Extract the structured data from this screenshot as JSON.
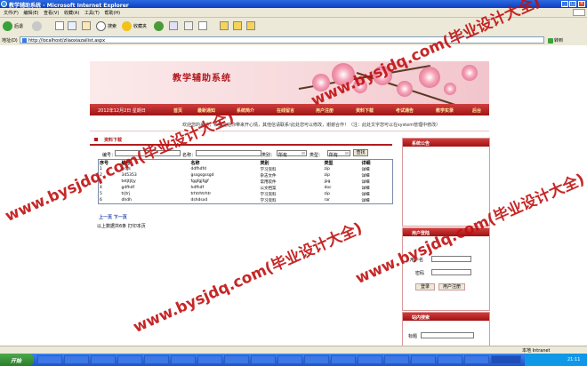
{
  "window": {
    "title": "教学辅助系统 - Microsoft Internet Explorer",
    "menu": [
      "文件(F)",
      "编辑(E)",
      "查看(V)",
      "收藏(A)",
      "工具(T)",
      "帮助(H)"
    ],
    "toolbar": {
      "back": "后退",
      "search": "搜索",
      "favorites": "收藏夹"
    },
    "address_label": "地址(D)",
    "url": "http://localhost/zliaoxiazailist.aspx",
    "go_label": "转到"
  },
  "site": {
    "title": "教学辅助系统",
    "date": "2012年12月2日 星期日",
    "nav": [
      "首页",
      "最新通知",
      "系统简介",
      "在线留言",
      "用户注册",
      "资料下载",
      "考试通告",
      "教学实录",
      "后台"
    ],
    "ticker": "欢迎您的来访，希望能给你带来开心情，其他信请联系!此处您可以修改，谢谢合作！（注：此处文字您可以在system管理中修改）"
  },
  "main": {
    "crumb": "资料下载",
    "search": {
      "code_label": "编号：",
      "name_label": "名称：",
      "category_label": "类别：",
      "category_value": "所有",
      "type_label": "类型：",
      "type_value": "所有",
      "button": "查找"
    },
    "columns": [
      "序号",
      "编号",
      "名称",
      "类别",
      "类型",
      "详细"
    ],
    "rows": [
      [
        "1",
        "gsgs",
        "ddfhdfd",
        "学习资料",
        "zip",
        "详细"
      ],
      [
        "2",
        "345353",
        "gssgsgssgd",
        "杂志文件",
        "zip",
        "详细"
      ],
      [
        "3",
        "tetjtjtjy",
        "fggfgjfgjf",
        "常用软件",
        "jpg",
        "详细"
      ],
      [
        "4",
        "gdfhdf",
        "hdfhdf",
        "公文档案",
        "doc",
        "详细"
      ],
      [
        "5",
        "trjtrj",
        "trhtrhtrhtr",
        "学习资料",
        "zip",
        "详细"
      ],
      [
        "6",
        "dhdh",
        "dshdsxd",
        "学习资料",
        "rar",
        "详细"
      ]
    ],
    "pager": [
      "上一页",
      "下一页"
    ],
    "summary": "以上数据共6条  打印本页"
  },
  "sidebar": {
    "notice_title": "系统公告",
    "login_title": "用户登陆",
    "username_label": "用户名",
    "password_label": "密码",
    "login_button": "登录",
    "register_button": "用户注册",
    "search_title": "站内搜索",
    "search_label": "标题"
  },
  "status": {
    "zone": "本地 Intranet"
  },
  "taskbar": {
    "start": "开始",
    "clock": "21:11"
  },
  "watermark": "www.bysjdq.com(毕业设计大全)",
  "colors": {
    "accent": "#b3151b",
    "nav": "#a31616"
  }
}
